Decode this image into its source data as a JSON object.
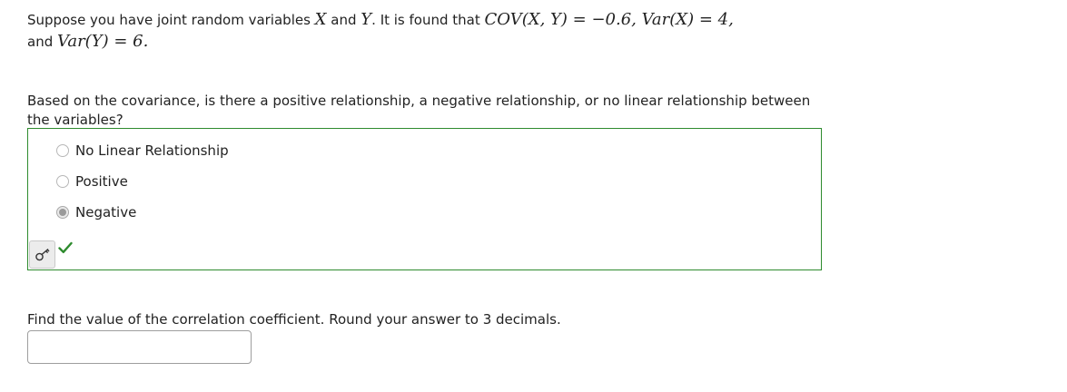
{
  "intro": {
    "t1": "Suppose you have joint random variables ",
    "m_x": "X",
    "t2": " and ",
    "m_y": "Y",
    "t3": ". It is found that ",
    "m_cov": "COV(X, Y) = −0.6, Var(X) = 4,",
    "t4": "and ",
    "m_vary": "Var(Y) = 6."
  },
  "question1": {
    "text": "Based on the covariance, is there a positive relationship, a negative relationship, or no linear relationship between the variables?",
    "options": [
      {
        "label": "No Linear Relationship",
        "selected": false
      },
      {
        "label": "Positive",
        "selected": false
      },
      {
        "label": "Negative",
        "selected": true
      }
    ],
    "key_icon": "key-icon",
    "result_icon": "checkmark-icon",
    "result_color": "#2e8b2e"
  },
  "question2": {
    "text": "Find the value of the correlation coefficient. Round your answer to 3 decimals.",
    "answer_value": ""
  }
}
